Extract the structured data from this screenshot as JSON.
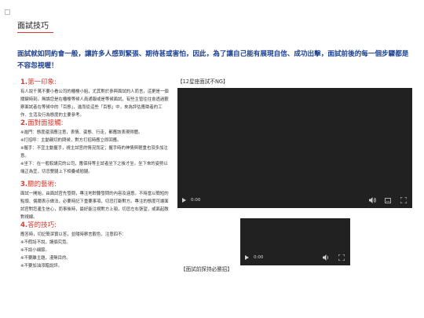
{
  "header": {
    "title": "面試技巧"
  },
  "intro": "面試就如同約會一般，讓許多人感到緊張、期待甚或害怕，因此，為了讓自己能有展現自信、成功出擊，面試前後的每一個步驟都是不容忽視喔！",
  "sections": [
    {
      "num": "1.",
      "title": "第一印象:",
      "paras": [
        "有人說千萬不要小看公司的櫃檯小姐，尤其對於參與面試的人而言，這更是一個關鍵時刻。無論您是在櫃檯等候人員通報或是等候面試，有些主管往往會透過觀察面試者在等候中的「百態」，進而從這些「百態」中，來為評估應徵者的工作、生活及行為態度的主要參考。"
      ]
    },
    {
      "num": "2.",
      "title": "面對面接觸:",
      "paras": [
        "※進門：態度還須應注意，表情、姿態、行走，都應該表現得體。",
        "※打招呼：主動親切的問候，對方打招時應立即回應。",
        "※握手：不宜主動握手，視主試官的情況而定；握手時的神情與輕重也須多加注意。",
        "※坐下：在一般較講究的公司，應保持等主試者坐下之後才坐。坐下來的姿勢以端正為宜，切忌雙腿上下相疊或翹腿。"
      ]
    },
    {
      "num": "3.",
      "title": "聽的藝術:",
      "paras": [
        "面試一開始，由面試官先發問，專注地聆聽發問的內容及涵意。不時當以簡短的點頭、偶爾表示做法，必要時記下重要事項，切忌打斷對方。專注的態度可讓面試官對您產生信心，而事後時，最好能注視對方上顎，切忌左右張望，或面起敵對視線。"
      ]
    },
    {
      "num": "4.",
      "title": "答的技巧:",
      "paras": [
        "應答時，切記簡潔實以答，並隨時察言觀色，注意四不：",
        "※不假話不說，講個究竟。",
        "※不談小細節。",
        "※不要離主題，漫無目的。",
        "※不要加油添醋說評。"
      ]
    }
  ],
  "videos": [
    {
      "caption": "【12星座面試不NG】",
      "time": "0:00"
    },
    {
      "caption": "【面試前探持必勝招】",
      "time": "0:00"
    }
  ]
}
